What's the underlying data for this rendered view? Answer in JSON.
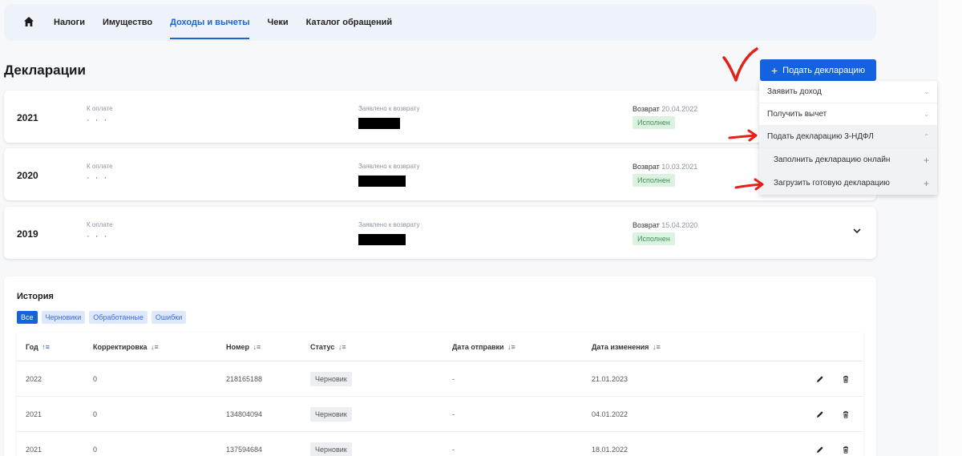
{
  "nav": {
    "items": [
      {
        "label": "Налоги",
        "active": false
      },
      {
        "label": "Имущество",
        "active": false
      },
      {
        "label": "Доходы и вычеты",
        "active": true
      },
      {
        "label": "Чеки",
        "active": false
      },
      {
        "label": "Каталог обращений",
        "active": false
      }
    ]
  },
  "page": {
    "title": "Декларации"
  },
  "submit_button": {
    "label": "Подать декларацию"
  },
  "declarations": [
    {
      "year": "2021",
      "to_pay_label": "К оплате",
      "to_pay": "· · ·",
      "claimed_label": "Заявлено к возврату",
      "return_label": "Возврат",
      "return_date": "20.04.2022",
      "status": "Исполнен"
    },
    {
      "year": "2020",
      "to_pay_label": "К оплате",
      "to_pay": "· · ·",
      "claimed_label": "Заявлено к возврату",
      "return_label": "Возврат",
      "return_date": "10.03.2021",
      "status": "Исполнен"
    },
    {
      "year": "2019",
      "to_pay_label": "К оплате",
      "to_pay": "· · ·",
      "claimed_label": "Заявлено к возврату",
      "return_label": "Возврат",
      "return_date": "15.04.2020",
      "status": "Исполнен"
    }
  ],
  "menu": {
    "items": [
      {
        "label": "Заявить доход"
      },
      {
        "label": "Получить вычет"
      },
      {
        "label": "Подать декларацию 3-НДФЛ"
      },
      {
        "label": "Заполнить декларацию онлайн"
      },
      {
        "label": "Загрузить готовую декларацию"
      }
    ]
  },
  "history": {
    "title": "История",
    "filters": [
      {
        "label": "Все",
        "active": true
      },
      {
        "label": "Черновики",
        "active": false
      },
      {
        "label": "Обработанные",
        "active": false
      },
      {
        "label": "Ошибки",
        "active": false
      }
    ],
    "columns": [
      "Год",
      "Корректировка",
      "Номер",
      "Статус",
      "Дата отправки",
      "Дата изменения"
    ],
    "rows": [
      {
        "year": "2022",
        "correction": "0",
        "number": "218165188",
        "status": "Черновик",
        "sent": "-",
        "changed": "21.01.2023"
      },
      {
        "year": "2021",
        "correction": "0",
        "number": "134804094",
        "status": "Черновик",
        "sent": "-",
        "changed": "04.01.2022"
      },
      {
        "year": "2021",
        "correction": "0",
        "number": "137594684",
        "status": "Черновик",
        "sent": "-",
        "changed": "18.01.2022"
      }
    ]
  },
  "colors": {
    "accent": "#1462e0",
    "success_bg": "#dcf2e0",
    "success_text": "#3f9457",
    "annotation": "#e4201b"
  }
}
